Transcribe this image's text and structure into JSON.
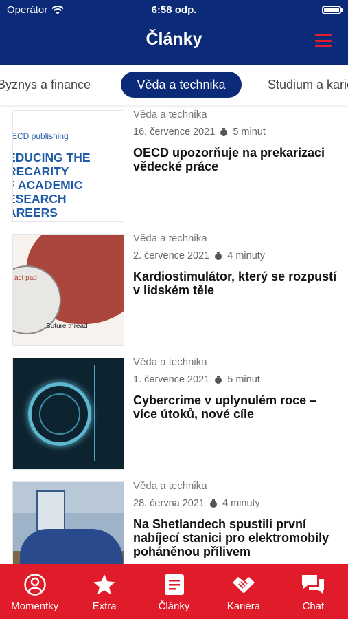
{
  "status_bar": {
    "carrier": "Operátor",
    "time": "6:58 odp."
  },
  "header": {
    "title": "Články"
  },
  "tabs": [
    {
      "label": "Byznys a finance"
    },
    {
      "label": "Věda a technika",
      "active": true
    },
    {
      "label": "Studium a kariéra"
    }
  ],
  "articles": [
    {
      "category": "Věda a technika",
      "date": "16. července 2021",
      "read_time": "5 minut",
      "title": "OECD upozorňuje na prekarizaci vědecké práce",
      "thumb": {
        "brand": "ECD publishing",
        "cover": "EDUCING THE\nRECARITY\nF ACADEMIC\nESEARCH\nAREERS"
      }
    },
    {
      "category": "Věda a technika",
      "date": "2. července 2021",
      "read_time": "4 minuty",
      "title": "Kardiostimulátor, který se rozpustí v lidském těle",
      "thumb": {
        "label1": "act pad",
        "label2": "Suture thread"
      }
    },
    {
      "category": "Věda a technika",
      "date": "1. července 2021",
      "read_time": "5 minut",
      "title": "Cybercrime v uplynulém roce – více útoků, nové cíle"
    },
    {
      "category": "Věda a technika",
      "date": "28. června 2021",
      "read_time": "4 minuty",
      "title": "Na Shetlandech spustili první nabíjecí stanici pro elektromobily poháněnou přílivem"
    }
  ],
  "bottom_nav": [
    {
      "label": "Momentky",
      "icon": "person-circle-icon"
    },
    {
      "label": "Extra",
      "icon": "star-icon"
    },
    {
      "label": "Články",
      "icon": "article-icon",
      "active": true
    },
    {
      "label": "Kariéra",
      "icon": "handshake-icon"
    },
    {
      "label": "Chat",
      "icon": "chat-icon"
    }
  ],
  "colors": {
    "header_bg": "#0b2a78",
    "accent_red": "#e01b2a",
    "active_tab_bg": "#0b2a78"
  }
}
